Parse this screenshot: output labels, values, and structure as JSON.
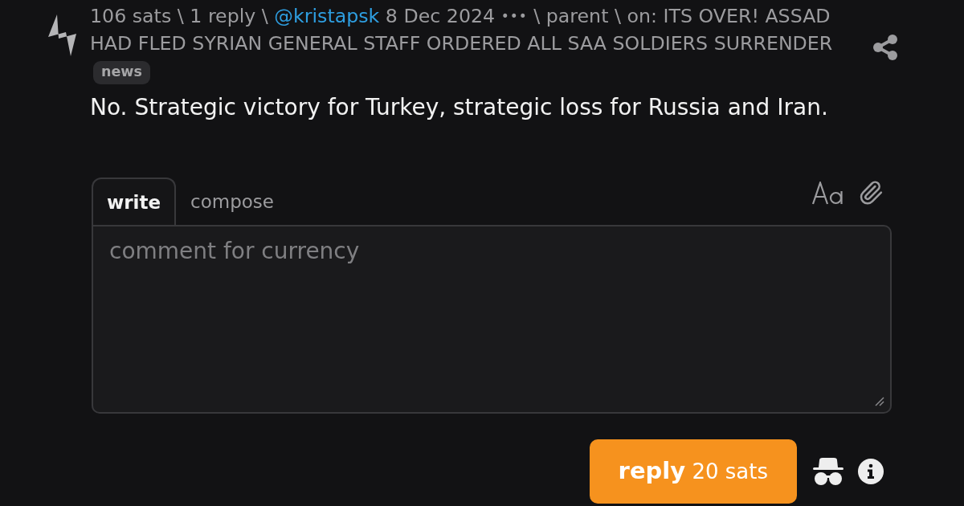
{
  "item": {
    "meta": [
      {
        "kind": "link",
        "text": "106 sats"
      },
      {
        "kind": "separator",
        "text": "\\"
      },
      {
        "kind": "link",
        "text": "1 reply"
      },
      {
        "kind": "separator",
        "text": "\\"
      },
      {
        "kind": "user",
        "text": "@kristapsk"
      },
      {
        "kind": "link",
        "text": "8 Dec 2024"
      },
      {
        "kind": "menu",
        "text": "•••"
      },
      {
        "kind": "separator",
        "text": "\\"
      },
      {
        "kind": "link",
        "text": "parent"
      },
      {
        "kind": "separator",
        "text": "\\"
      },
      {
        "kind": "text",
        "text": "on:"
      },
      {
        "kind": "title",
        "lines": [
          "ITS OVER! ASSAD",
          "HAD FLED SYRIAN GENERAL STAFF ORDERED ALL SAA SOLDIERS SURRENDER"
        ]
      }
    ],
    "tags": [
      {
        "text": "news"
      }
    ],
    "text": "No. Strategic victory for Turkey, strategic loss for Russia and Iran."
  },
  "editor": {
    "tabs": [
      {
        "label": "write",
        "selected": true
      },
      {
        "label": "compose",
        "selected": false
      }
    ],
    "placeholder": "comment for currency"
  },
  "reply_button": {
    "label": "**reply** 20 sats"
  }
}
